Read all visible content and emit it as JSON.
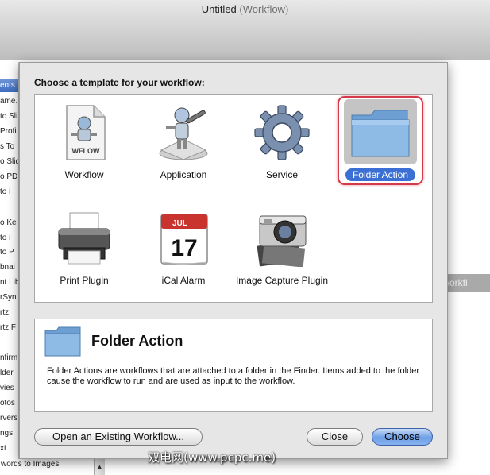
{
  "window": {
    "title": "Untitled",
    "subtitle": "(Workflow)"
  },
  "background_list": {
    "header": "ents",
    "items": [
      "ame.",
      "to Sli",
      "Profi",
      "s To",
      "o Slid",
      "o PD",
      "to i",
      "o Ke",
      "to i",
      "to P",
      "bnai",
      "nt Lib",
      "rSyn",
      "rtz",
      "rtz F",
      "nfirm",
      "lder",
      "vies",
      "otos",
      "rvers",
      "ngs",
      "xt"
    ],
    "last_item": "words to Images",
    "right_text": "r workfl"
  },
  "dialog": {
    "heading": "Choose a template for your workflow:",
    "templates": [
      {
        "label": "Workflow",
        "icon": "wflow-document-icon",
        "badge": "WFLOW"
      },
      {
        "label": "Application",
        "icon": "automator-robot-icon"
      },
      {
        "label": "Service",
        "icon": "gear-icon"
      },
      {
        "label": "Folder Action",
        "icon": "folder-icon",
        "selected": true
      },
      {
        "label": "Print Plugin",
        "icon": "printer-icon"
      },
      {
        "label": "iCal Alarm",
        "icon": "calendar-icon",
        "month": "JUL",
        "day": "17"
      },
      {
        "label": "Image Capture Plugin",
        "icon": "camera-icon"
      }
    ],
    "description": {
      "title": "Folder Action",
      "body": "Folder Actions are workflows that are attached to a folder in the Finder. Items added to the folder cause the workflow to run and are used as input to the workflow."
    },
    "buttons": {
      "open_existing": "Open an Existing Workflow...",
      "close": "Close",
      "choose": "Choose"
    }
  },
  "watermark": "双电网(www.pcpc.me)",
  "colors": {
    "accent": "#3b6fd4",
    "selection_ring": "#d43a4a",
    "folder_blue": "#7fb0e0"
  }
}
